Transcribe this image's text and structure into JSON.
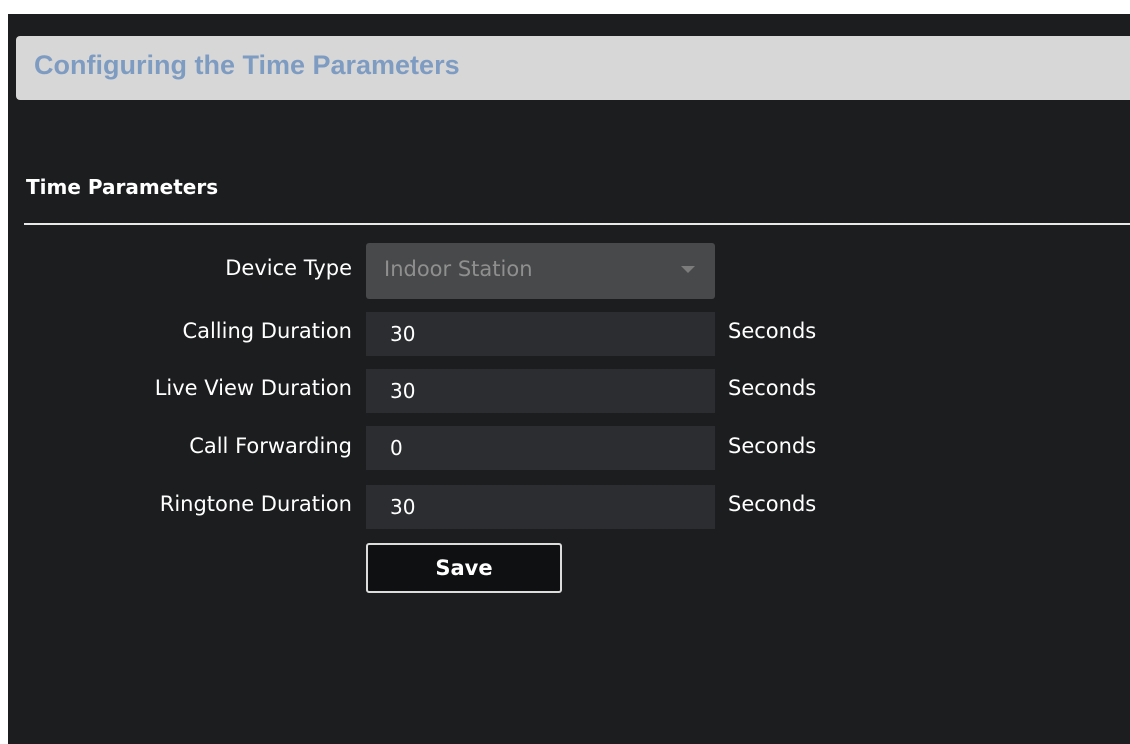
{
  "header": {
    "title": "Configuring the Time Parameters"
  },
  "section": {
    "title": "Time Parameters"
  },
  "form": {
    "device_type": {
      "label": "Device Type",
      "selected": "Indoor Station"
    },
    "calling_duration": {
      "label": "Calling Duration",
      "value": "30",
      "unit": "Seconds"
    },
    "live_view_duration": {
      "label": "Live View Duration",
      "value": "30",
      "unit": "Seconds"
    },
    "call_forwarding": {
      "label": "Call Forwarding",
      "value": "0",
      "unit": "Seconds"
    },
    "ringtone_duration": {
      "label": "Ringtone Duration",
      "value": "30",
      "unit": "Seconds"
    },
    "save_label": "Save"
  },
  "colors": {
    "panel_background": "#1b1d1f",
    "title_bar_background": "#d7d7d7",
    "title_text": "#7e9cc2",
    "input_background": "#2b2d30",
    "select_background": "#48494b"
  }
}
